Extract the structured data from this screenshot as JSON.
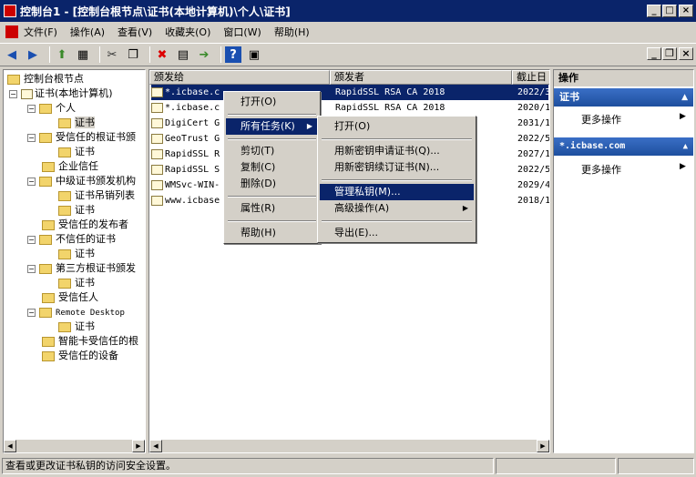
{
  "window": {
    "title": "控制台1 - [控制台根节点\\证书(本地计算机)\\个人\\证书]"
  },
  "menubar": [
    "文件(F)",
    "操作(A)",
    "查看(V)",
    "收藏夹(O)",
    "窗口(W)",
    "帮助(H)"
  ],
  "tree": {
    "root": "控制台根节点",
    "cert_store": "证书(本地计算机)",
    "personal": "个人",
    "certs": "证书",
    "trusted_root": "受信任的根证书颁",
    "enterprise": "企业信任",
    "intermediate": "中级证书颁发机构",
    "crl": "证书吊销列表",
    "trusted_publishers": "受信任的发布者",
    "untrusted": "不信任的证书",
    "third_party": "第三方根证书颁发",
    "trusted_people": "受信任人",
    "remote_desktop": "Remote Desktop",
    "smartcard": "智能卡受信任的根",
    "trusted_devices": "受信任的设备"
  },
  "list": {
    "headers": [
      "颁发给",
      "颁发者",
      "截止日"
    ],
    "rows": [
      {
        "to": "*.icbase.c",
        "by": "RapidSSL RSA CA 2018",
        "exp": "2022/3"
      },
      {
        "to": "*.icbase.c",
        "by": "RapidSSL RSA CA 2018",
        "exp": "2020/1"
      },
      {
        "to": "DigiCert G",
        "by": "",
        "exp": "2031/1"
      },
      {
        "to": "GeoTrust G",
        "by": "",
        "exp": "2022/5"
      },
      {
        "to": "RapidSSL R",
        "by": "",
        "exp": "2027/1"
      },
      {
        "to": "RapidSSL S",
        "by": "",
        "exp": "2022/5"
      },
      {
        "to": "WMSvc-WIN-",
        "by": "",
        "exp": "2029/4"
      },
      {
        "to": "www.icbase",
        "by": "",
        "exp": "2018/1"
      }
    ]
  },
  "context_menu": {
    "open": "打开(O)",
    "all_tasks": "所有任务(K)",
    "cut": "剪切(T)",
    "copy": "复制(C)",
    "delete": "删除(D)",
    "properties": "属性(R)",
    "help": "帮助(H)"
  },
  "submenu": {
    "open": "打开(O)",
    "renew_same": "用新密钥申请证书(Q)...",
    "renew_new": "用新密钥续订证书(N)...",
    "manage_keys": "管理私钥(M)...",
    "advanced": "高级操作(A)",
    "export": "导出(E)..."
  },
  "actions": {
    "title": "操作",
    "section1": "证书",
    "more1": "更多操作",
    "section2": "*.icbase.com",
    "more2": "更多操作"
  },
  "status": "查看或更改证书私钥的访问安全设置。"
}
